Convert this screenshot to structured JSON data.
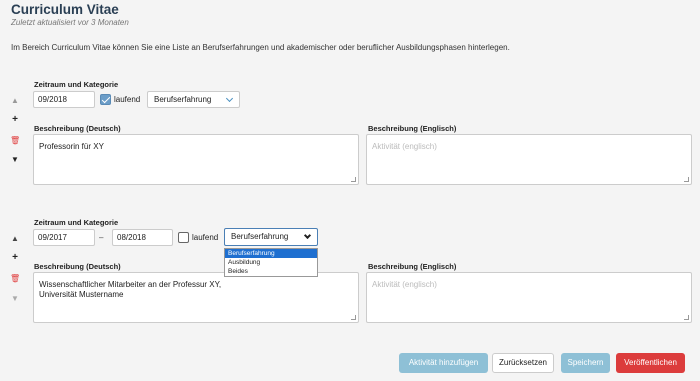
{
  "header": {
    "title": "Curriculum Vitae",
    "subtitle": "Zuletzt aktualisiert vor 3 Monaten",
    "intro": "Im Bereich Curriculum Vitae können Sie eine Liste an Berufserfahrungen und akademischer oder beruflicher Ausbildungsphasen hinterlegen."
  },
  "entries": [
    {
      "period_label": "Zeitraum und Kategorie",
      "start": "09/2018",
      "end": "",
      "ongoing": true,
      "ongoing_label": "laufend",
      "category": "Berufserfahrung",
      "desc_de_label": "Beschreibung (Deutsch)",
      "desc_de": "Professorin für XY",
      "desc_en_label": "Beschreibung (Englisch)",
      "desc_en_placeholder": "Aktivität (englisch)"
    },
    {
      "period_label": "Zeitraum und Kategorie",
      "start": "09/2017",
      "separator": "–",
      "end": "08/2018",
      "ongoing": false,
      "ongoing_label": "laufend",
      "category": "Berufserfahrung",
      "desc_de_label": "Beschreibung (Deutsch)",
      "desc_de_line1": "Wissenschaftlicher Mitarbeiter an der Professur XY,",
      "desc_de_line2": "Universität Mustername",
      "desc_en_label": "Beschreibung (Englisch)",
      "desc_en_placeholder": "Aktivität (englisch)"
    }
  ],
  "dropdown": {
    "options": [
      "Berufserfahrung",
      "Ausbildung",
      "Beides"
    ],
    "selected": "Berufserfahrung"
  },
  "controls": {
    "up": "▲",
    "add": "+",
    "delete": "🗑",
    "down": "▼"
  },
  "footer": {
    "add_label": "Aktivität hinzufügen",
    "reset_label": "Zurücksetzen",
    "save_label": "Speichern",
    "publish_label": "Veröffentlichen"
  },
  "colors": {
    "primary_light": "#8ec0d6",
    "danger": "#dc3c3c",
    "title": "#2a3f54"
  }
}
